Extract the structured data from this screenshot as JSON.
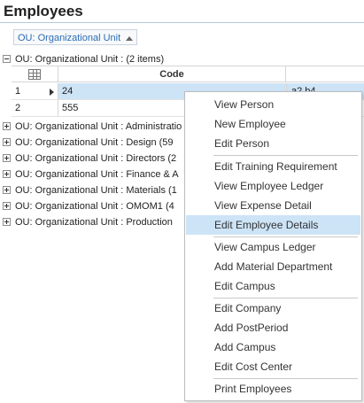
{
  "page": {
    "title": "Employees"
  },
  "group_panel": {
    "chip_label": "OU: Organizational Unit"
  },
  "groups": [
    {
      "label": "OU: Organizational Unit :  (2 items)",
      "expanded": true
    },
    {
      "label": "OU: Organizational Unit : Administratio"
    },
    {
      "label": "OU: Organizational Unit : Design (59"
    },
    {
      "label": "OU: Organizational Unit : Directors (2"
    },
    {
      "label": "OU: Organizational Unit : Finance & A"
    },
    {
      "label": "OU: Organizational Unit : Materials (1"
    },
    {
      "label": "OU: Organizational Unit : OMOM1 (4"
    },
    {
      "label": "OU: Organizational Unit : Production"
    }
  ],
  "grid": {
    "columns": {
      "code": "Code"
    },
    "rows": [
      {
        "num": "1",
        "code": "24",
        "extra": "a2 b4",
        "selected": true
      },
      {
        "num": "2",
        "code": "555",
        "extra": ""
      }
    ]
  },
  "context_menu": {
    "sections": [
      [
        "View Person",
        "New Employee",
        "Edit Person"
      ],
      [
        "Edit Training Requirement",
        "View Employee Ledger",
        "View Expense Detail",
        "Edit Employee Details"
      ],
      [
        "View Campus Ledger",
        "Add Material Department",
        "Edit Campus"
      ],
      [
        "Edit Company",
        "Add PostPeriod",
        "Add Campus",
        "Edit Cost Center"
      ],
      [
        "Print Employees"
      ]
    ],
    "highlighted": "Edit Employee Details"
  },
  "colors": {
    "accent": "#2b6cb5",
    "selection": "#cde4f7"
  }
}
